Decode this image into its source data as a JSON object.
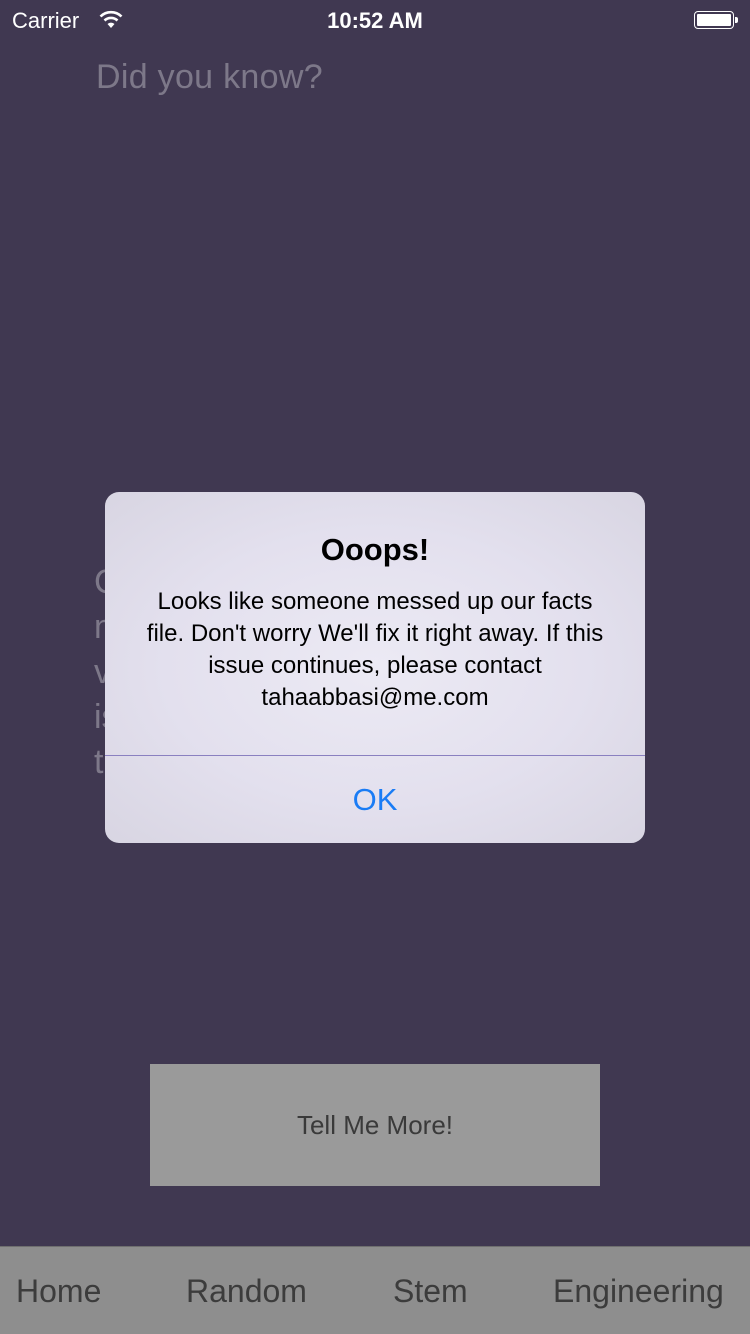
{
  "status_bar": {
    "carrier": "Carrier",
    "time": "10:52 AM",
    "wifi_icon": "wifi-icon",
    "battery_icon": "battery-icon"
  },
  "main": {
    "heading": "Did you know?",
    "fact_partial": "C\nn\nv\nis\nt",
    "button_label": "Tell Me More!"
  },
  "tab_bar": {
    "tabs": [
      "Home",
      "Random",
      "Stem",
      "Engineering"
    ]
  },
  "alert": {
    "title": "Ooops!",
    "message": "Looks like someone messed up our facts file. Don't worry We'll fix it right away. If this issue continues, please contact tahaabbasi@me.com",
    "ok_label": "OK",
    "ok_color": "#1a7cf5"
  },
  "colors": {
    "background": "#403851",
    "button": "#9a9a9a",
    "tab_bar": "#8e8e8e"
  }
}
